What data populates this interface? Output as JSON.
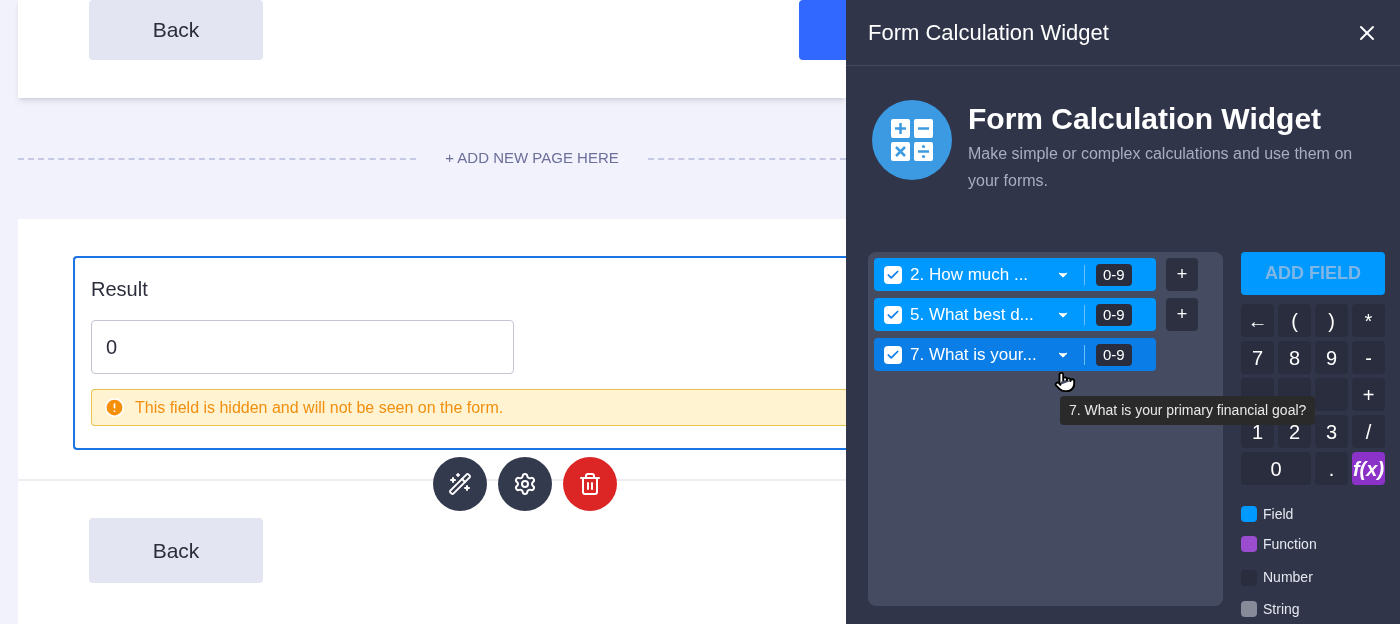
{
  "top_card": {
    "back_button": "Back"
  },
  "add_page": "+ ADD NEW PAGE HERE",
  "result_card": {
    "label": "Result",
    "value": "0",
    "warning": "This field is hidden and will not be seen on the form.",
    "back_button": "Back"
  },
  "panel": {
    "title": "Form Calculation Widget",
    "widget": {
      "name": "Form Calculation Widget",
      "description": "Make simple or complex calculations and use them on your forms."
    },
    "fields": [
      {
        "label": "2. How much ...",
        "checked": true,
        "range": "0-9",
        "hovered": false,
        "plus": "+"
      },
      {
        "label": "5. What best d...",
        "checked": true,
        "range": "0-9",
        "hovered": false,
        "plus": "+"
      },
      {
        "label": "7. What is your...",
        "checked": true,
        "range": "0-9",
        "hovered": true
      }
    ],
    "tooltip": "7. What is your primary financial goal?",
    "add_field": "ADD FIELD",
    "keys": [
      {
        "kind": "key",
        "label": "←"
      },
      {
        "kind": "key",
        "label": "("
      },
      {
        "kind": "key",
        "label": ")"
      },
      {
        "kind": "key",
        "label": "*"
      },
      {
        "kind": "key",
        "label": "7"
      },
      {
        "kind": "key",
        "label": "8"
      },
      {
        "kind": "key",
        "label": "9"
      },
      {
        "kind": "key",
        "label": "-"
      },
      {
        "kind": "covered"
      },
      {
        "kind": "covered"
      },
      {
        "kind": "covered"
      },
      {
        "kind": "key",
        "label": "+"
      },
      {
        "kind": "key",
        "label": "1"
      },
      {
        "kind": "key",
        "label": "2"
      },
      {
        "kind": "key",
        "label": "3"
      },
      {
        "kind": "key",
        "label": "/"
      },
      {
        "kind": "wide",
        "label": "0"
      },
      {
        "kind": "key",
        "label": "."
      },
      {
        "kind": "function",
        "label": "f(x)"
      }
    ],
    "legend": [
      {
        "label": "Field",
        "color": "#0099ff"
      },
      {
        "label": "Function",
        "color": "#9b4ccf"
      },
      {
        "label": "Number",
        "color": "#292d3d"
      },
      {
        "label": "String",
        "color": "#878a99"
      }
    ]
  }
}
